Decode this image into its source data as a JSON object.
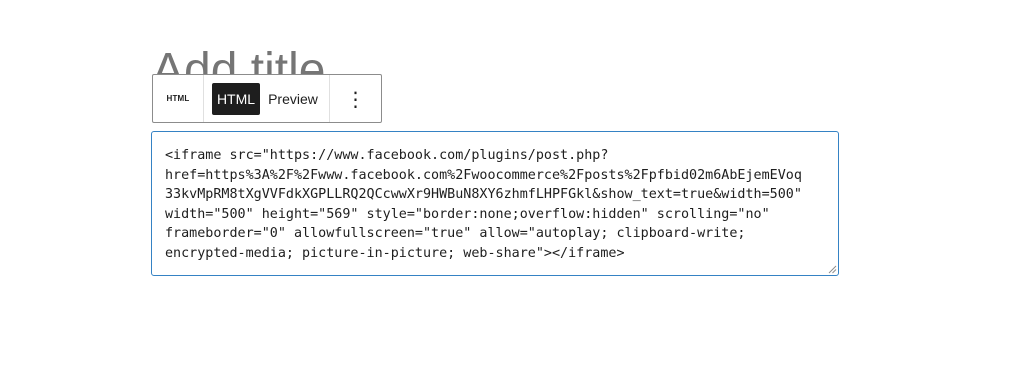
{
  "editor": {
    "title_placeholder": "Add title"
  },
  "toolbar": {
    "block_type_icon_text": "HTML",
    "mode_html_label": "HTML",
    "mode_preview_label": "Preview",
    "more_options_glyph": "⋮",
    "active_mode": "HTML"
  },
  "html_block": {
    "lines": [
      "<iframe src=\"https://www.facebook.com/plugins/post.php?",
      "href=https%3A%2F%2Fwww.facebook.com%2Fwoocommerce%2Fposts%2Fpfbid02m6AbEjemEVoq",
      "33kvMpRM8tXgVVFdkXGPLLRQ2QCcwwXr9HWBuN8XY6zhmfLHPFGkl&show_text=true&width=500\"",
      "width=\"500\" height=\"569\" style=\"border:none;overflow:hidden\" scrolling=\"no\"",
      "frameborder=\"0\" allowfullscreen=\"true\" allow=\"autoplay; clipboard-write;",
      "encrypted-media; picture-in-picture; web-share\"></iframe>"
    ]
  },
  "colors": {
    "accent_focus": "#3582c4",
    "toolbar_active_bg": "#1e1e1e",
    "placeholder_text": "#757575",
    "toolbar_border": "#8c8c8c"
  },
  "icons": {
    "block_type": "html-block-icon",
    "more": "vertical-ellipsis-icon",
    "resize": "resize-grip-icon"
  }
}
